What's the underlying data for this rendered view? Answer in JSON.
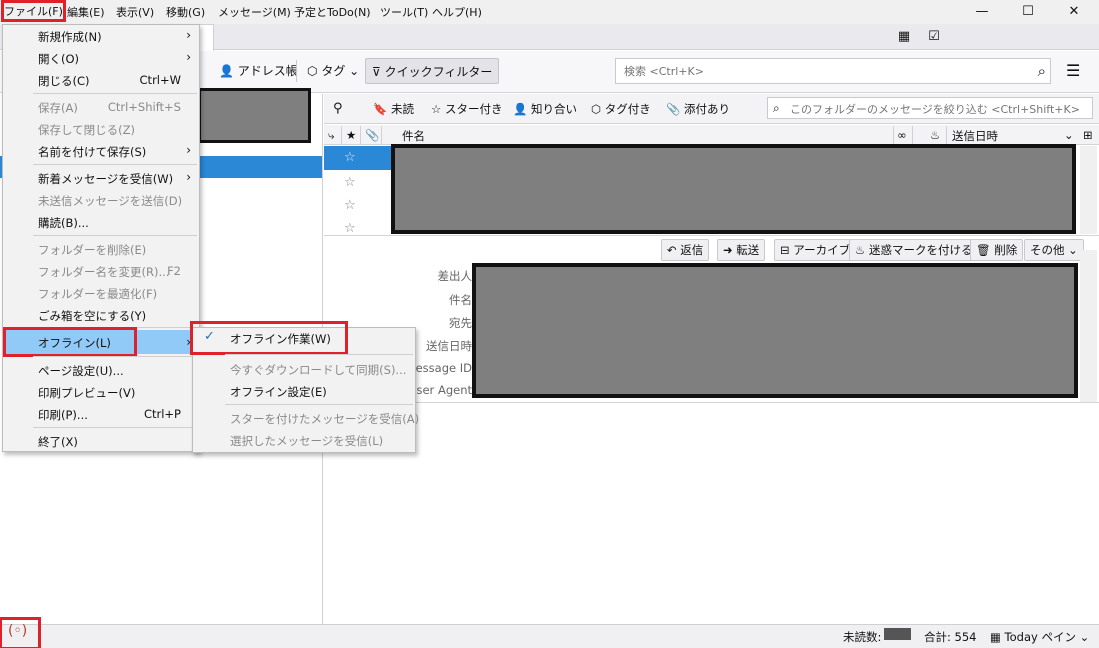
{
  "menubar": {
    "items": [
      "ファイル(F)",
      "編集(E)",
      "表示(V)",
      "移動(G)",
      "メッセージ(M)",
      "予定とToDo(N)",
      "ツール(T)",
      "ヘルプ(H)"
    ]
  },
  "window": {
    "minimize": "—",
    "maximize": "☐",
    "close": "✕"
  },
  "toolbar": {
    "address_book": "アドレス帳",
    "tag": "タグ",
    "quick_filter": "クイックフィルター",
    "search_placeholder": "検索 <Ctrl+K>"
  },
  "quick_filter_bar": {
    "unread": "未読",
    "starred": "スター付き",
    "contacts": "知り合い",
    "tagged": "タグ付き",
    "attachment": "添付あり",
    "filter_placeholder": "このフォルダーのメッセージを絞り込む <Ctrl+Shift+K>"
  },
  "thread_columns": {
    "subject": "件名",
    "date": "送信日時"
  },
  "message_actions": {
    "reply": "返信",
    "forward": "転送",
    "archive": "アーカイブ",
    "junk": "迷惑マークを付ける",
    "delete": "削除",
    "other": "その他"
  },
  "header_labels": [
    "差出人",
    "件名",
    "宛先",
    "送信日時",
    "Message ID",
    "User Agent"
  ],
  "file_menu": {
    "new": "新規作成(N)",
    "open": "開く(O)",
    "close": "閉じる(C)",
    "close_sc": "Ctrl+W",
    "save": "保存(A)",
    "save_sc": "Ctrl+Shift+S",
    "save_close": "保存して閉じる(Z)",
    "save_as": "名前を付けて保存(S)",
    "get_messages": "新着メッセージを受信(W)",
    "send_unsent": "未送信メッセージを送信(D)",
    "subscribe": "購読(B)...",
    "delete_folder": "フォルダーを削除(E)",
    "rename_folder": "フォルダー名を変更(R)...",
    "rename_sc": "F2",
    "compact_folder": "フォルダーを最適化(F)",
    "empty_trash": "ごみ箱を空にする(Y)",
    "offline": "オフライン(L)",
    "page_setup": "ページ設定(U)...",
    "print_preview": "印刷プレビュー(V)",
    "print": "印刷(P)...",
    "print_sc": "Ctrl+P",
    "quit": "終了(X)"
  },
  "offline_submenu": {
    "work_offline": "オフライン作業(W)",
    "download_sync": "今すぐダウンロードして同期(S)...",
    "offline_settings": "オフライン設定(E)",
    "get_starred": "スターを付けたメッセージを受信(A)",
    "get_selected": "選択したメッセージを受信(L)"
  },
  "statusbar": {
    "unread_label": "未読数:",
    "total": "合計: 554",
    "today_pane": "Today ペイン"
  }
}
